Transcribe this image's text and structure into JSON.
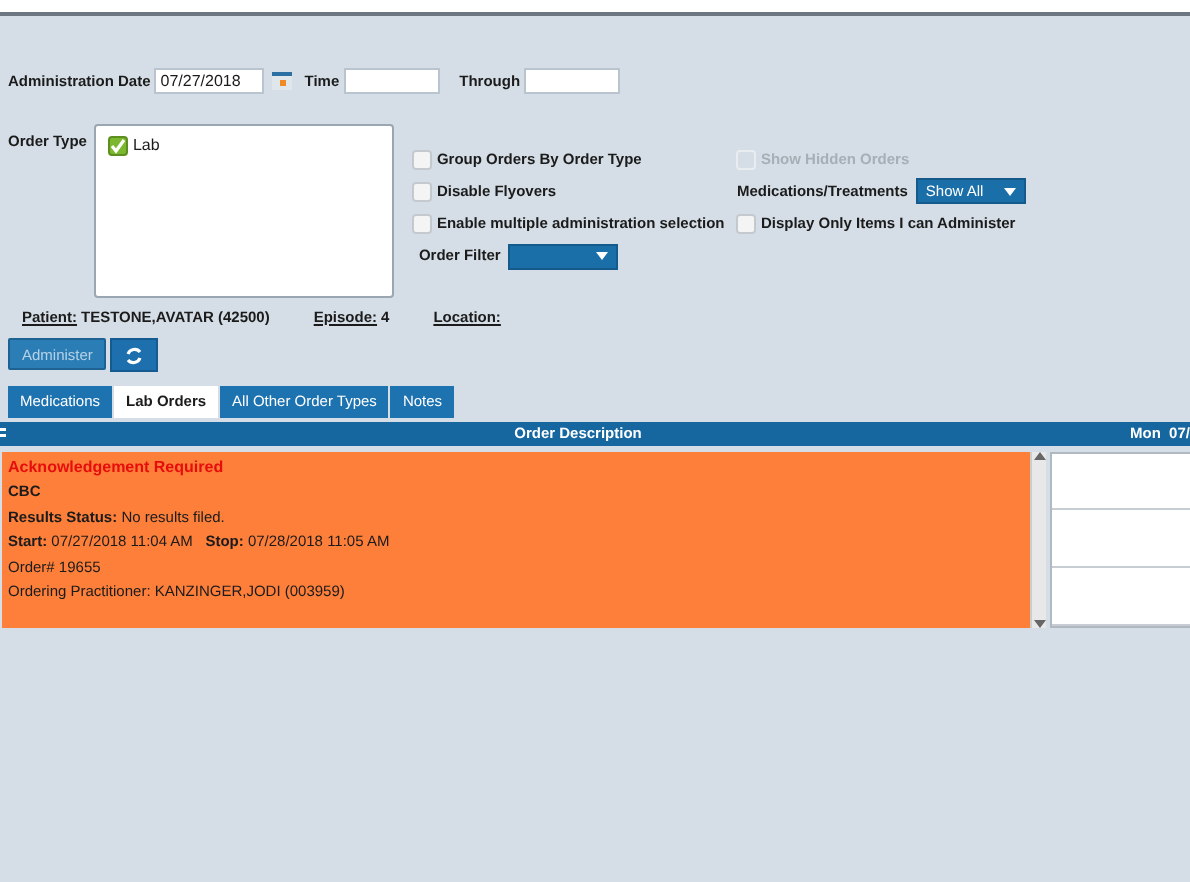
{
  "administration": {
    "date_label": "Administration Date",
    "date_value": "07/27/2018",
    "time_label": "Time",
    "through_label": "Through"
  },
  "order_type": {
    "label": "Order Type",
    "items": [
      {
        "label": "Lab",
        "checked": true
      }
    ]
  },
  "options": [
    {
      "kind": "checkbox",
      "label": "Group Orders By Order Type",
      "checked": false,
      "disabled": false
    },
    {
      "kind": "checkbox",
      "label": "Show Hidden Orders",
      "checked": false,
      "disabled": true
    },
    {
      "kind": "checkbox",
      "label": "Disable Flyovers",
      "checked": false,
      "disabled": false
    },
    {
      "kind": "select",
      "label": "Medications/Treatments",
      "value": "Show All"
    },
    {
      "kind": "checkbox",
      "label": "Enable multiple administration selection",
      "checked": false,
      "disabled": false
    },
    {
      "kind": "checkbox",
      "label": "Display Only Items I can Administer",
      "checked": false,
      "disabled": false
    },
    {
      "kind": "select",
      "label": "Order Filter"
    }
  ],
  "patient": [
    {
      "label": "Patient:",
      "value": "TESTONE,AVATAR (42500)"
    },
    {
      "label": "Episode:",
      "value": "4"
    },
    {
      "label": "Location:"
    }
  ],
  "administer": {
    "label": "Administer",
    "disabled": true
  },
  "tabs": [
    {
      "label": "Medications",
      "selected": false
    },
    {
      "label": "Lab Orders",
      "selected": true
    },
    {
      "label": "All Other Order Types",
      "selected": false
    },
    {
      "label": "Notes",
      "selected": false
    }
  ],
  "grid": {
    "columns": [
      "Order Description",
      "Mon  07/"
    ],
    "orders": [
      {
        "alert": "Acknowledgement Required",
        "name": "CBC",
        "lines": [
          "**Results Status:** No results filed.",
          "**Start:** 07/27/2018 11:04 AM   **Stop:** 07/28/2018 11:05 AM",
          "Order# 19655",
          "Ordering Practitioner: KANZINGER,JODI (003959)"
        ]
      }
    ]
  }
}
